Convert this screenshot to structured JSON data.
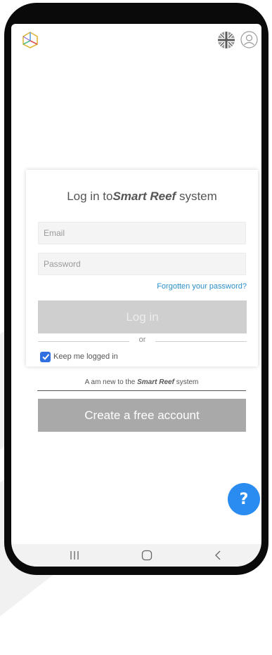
{
  "header": {
    "logo_icon": "cube-logo-icon",
    "language_icon": "uk-flag-icon",
    "account_icon": "user-icon"
  },
  "login": {
    "title_prefix": "Log in to",
    "title_brand": "Smart Reef",
    "title_suffix": " system",
    "email_placeholder": "Email",
    "email_value": "",
    "password_placeholder": "Password",
    "password_value": "",
    "forgot_label": "Forgotten your password?",
    "login_label": "Log in",
    "or_label": "or",
    "keep_logged_label": "Keep me logged in",
    "keep_logged_checked": true
  },
  "signup": {
    "prompt_prefix": "A am new to the ",
    "prompt_brand": "Smart Reef",
    "prompt_suffix": " system",
    "create_label": "Create a free account"
  },
  "help": {
    "label": "?"
  },
  "nav": {
    "recent_icon": "recent-apps-icon",
    "home_icon": "home-icon",
    "back_icon": "back-icon"
  },
  "colors": {
    "accent_blue": "#2a8cf0",
    "link_blue": "#2b8fc9",
    "checkbox_blue": "#2f6fe0",
    "login_button_disabled": "#cfcfcf",
    "create_button": "#a9a9a9"
  }
}
